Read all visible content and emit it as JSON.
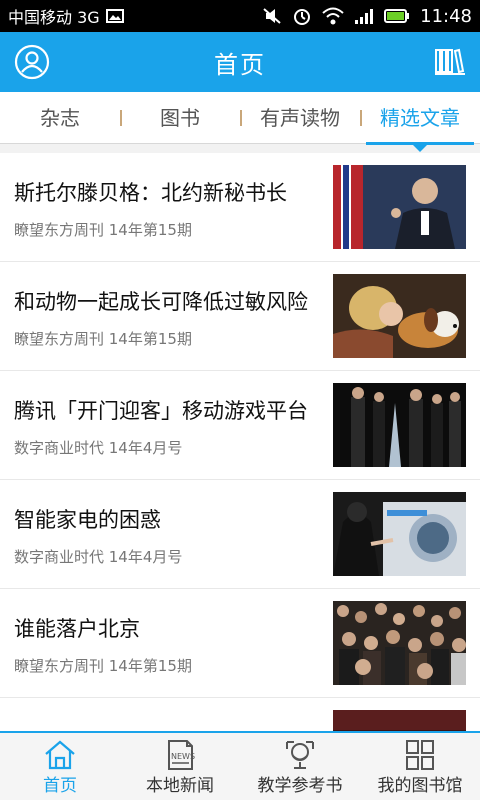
{
  "statusbar": {
    "carrier": "中国移动 3G",
    "time": "11:48"
  },
  "header": {
    "title": "首页"
  },
  "tabs": [
    {
      "label": "杂志"
    },
    {
      "label": "图书"
    },
    {
      "label": "有声读物"
    },
    {
      "label": "精选文章"
    }
  ],
  "articles": [
    {
      "title": "斯托尔滕贝格：北约新秘书长",
      "meta": "瞭望东方周刊 14年第15期"
    },
    {
      "title": "和动物一起成长可降低过敏风险",
      "meta": "瞭望东方周刊 14年第15期"
    },
    {
      "title": "腾讯「开门迎客」移动游戏平台",
      "meta": "数字商业时代 14年4月号"
    },
    {
      "title": "智能家电的困惑",
      "meta": "数字商业时代 14年4月号"
    },
    {
      "title": "谁能落户北京",
      "meta": "瞭望东方周刊 14年第15期"
    }
  ],
  "bottomnav": [
    {
      "label": "首页",
      "icon": "home-icon"
    },
    {
      "label": "本地新闻",
      "icon": "news-icon"
    },
    {
      "label": "教学参考书",
      "icon": "globe-icon"
    },
    {
      "label": "我的图书馆",
      "icon": "grid-icon"
    }
  ],
  "colors": {
    "accent": "#1aa3ea",
    "tab_divider": "#c9a77a"
  }
}
